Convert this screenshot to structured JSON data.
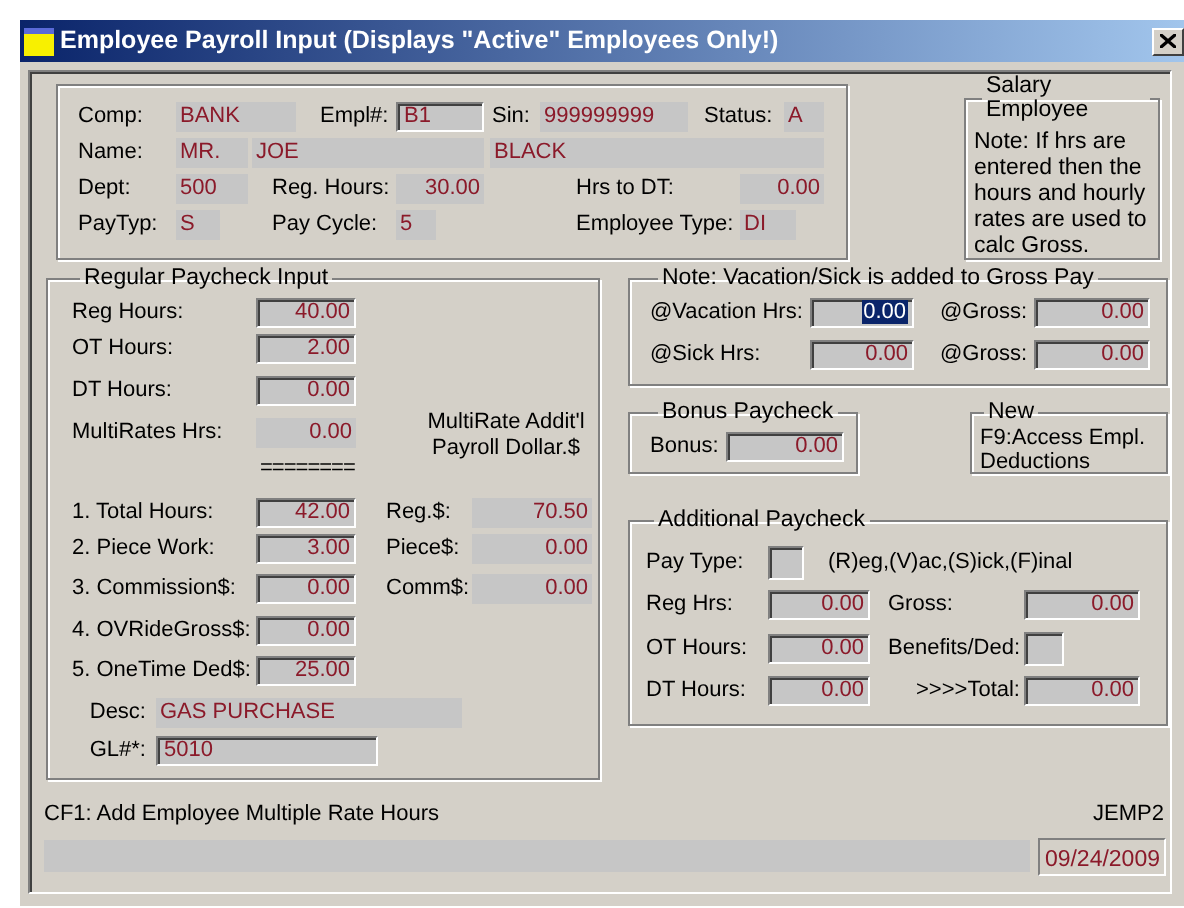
{
  "window": {
    "title": "Employee Payroll Input (Displays \"Active\" Employees Only!)"
  },
  "employee": {
    "comp": {
      "label": "Comp:",
      "value": "BANK",
      "sunken": false
    },
    "empl": {
      "label": "Empl#:",
      "value": "B1",
      "sunken": true
    },
    "sin": {
      "label": "Sin:",
      "value": "999999999",
      "sunken": false
    },
    "status": {
      "label": "Status:",
      "value": "A",
      "sunken": false
    },
    "name": {
      "label": "Name:",
      "values": [
        "MR.",
        "JOE",
        "BLACK"
      ]
    },
    "dept": {
      "label": "Dept:",
      "value": "500",
      "sunken": false
    },
    "reg_hours": {
      "label": "Reg. Hours:",
      "value": "30.00",
      "sunken": false
    },
    "hrs_to_dt": {
      "label": "Hrs to DT:",
      "value": "0.00",
      "sunken": false
    },
    "pay_typ": {
      "label": "PayTyp:",
      "value": "S",
      "sunken": false
    },
    "pay_cycle": {
      "label": "Pay Cycle:",
      "value": "5",
      "sunken": false
    },
    "employee_type": {
      "label": "Employee Type:",
      "value": "DI",
      "sunken": false
    }
  },
  "salary_note": {
    "title": "Salary Employee",
    "text": "Note: If hrs are entered then the hours and hourly rates are used to calc Gross."
  },
  "regular_paycheck": {
    "title": "Regular Paycheck Input",
    "reg_hours": {
      "label": "Reg Hours:",
      "value": "40.00",
      "sunken": true
    },
    "ot_hours": {
      "label": "OT Hours:",
      "value": "2.00",
      "sunken": true
    },
    "dt_hours": {
      "label": "DT Hours:",
      "value": "0.00",
      "sunken": true
    },
    "multirates_hrs": {
      "label": "MultiRates Hrs:",
      "value": "0.00",
      "sunken": false
    },
    "multirate_note": "MultiRate Addit'l Payroll Dollar.$",
    "separator": "========",
    "total_hours": {
      "label": "1. Total Hours:",
      "value": "42.00",
      "sunken": true
    },
    "reg_dollars": {
      "label": "Reg.$:",
      "value": "70.50",
      "sunken": false
    },
    "piece_work": {
      "label": "2. Piece Work:",
      "value": "3.00",
      "sunken": true
    },
    "piece_dollars": {
      "label": "Piece$:",
      "value": "0.00",
      "sunken": false
    },
    "commission": {
      "label": "3. Commission$:",
      "value": "0.00",
      "sunken": true
    },
    "comm_dollars": {
      "label": "Comm$:",
      "value": "0.00",
      "sunken": false
    },
    "ovride_gross": {
      "label": "4. OVRideGross$:",
      "value": "0.00",
      "sunken": true
    },
    "onetime_ded": {
      "label": "5. OneTime Ded$:",
      "value": "25.00",
      "sunken": true
    },
    "desc": {
      "label": "Desc:",
      "value": "GAS PURCHASE",
      "sunken": false
    },
    "gl": {
      "label": "GL#*:",
      "value": "5010",
      "sunken": true
    }
  },
  "vacation_sick": {
    "title": "Note: Vacation/Sick is added to Gross Pay",
    "fields": [
      {
        "label": "@Vacation Hrs:",
        "value": "0.00",
        "sunken": true,
        "highlighted": true
      },
      {
        "label": "@Gross:",
        "value": "0.00",
        "sunken": true,
        "highlighted": false
      },
      {
        "label": "@Sick Hrs:",
        "value": "0.00",
        "sunken": true,
        "highlighted": false
      },
      {
        "label": "@Gross:",
        "value": "0.00",
        "sunken": true,
        "highlighted": false
      }
    ]
  },
  "bonus": {
    "title": "Bonus Paycheck",
    "bonus": {
      "label": "Bonus:",
      "value": "0.00",
      "sunken": true
    }
  },
  "new_note": {
    "title": "New",
    "text": "F9:Access Empl. Deductions"
  },
  "additional": {
    "title": "Additional Paycheck",
    "pay_type": {
      "label": "Pay Type:",
      "sunken": true
    },
    "pay_type_hint": "(R)eg,(V)ac,(S)ick,(F)inal",
    "reg_hrs": {
      "label": "Reg Hrs:",
      "value": "0.00",
      "sunken": true
    },
    "gross": {
      "label": "Gross:",
      "value": "0.00",
      "sunken": true
    },
    "ot_hours": {
      "label": "OT Hours:",
      "value": "0.00",
      "sunken": true
    },
    "benefits_ded": {
      "label": "Benefits/Ded:",
      "sunken": true
    },
    "dt_hours": {
      "label": "DT Hours:",
      "value": "0.00",
      "sunken": true
    },
    "total": {
      "label": ">>>>Total:",
      "value": "0.00",
      "sunken": true
    }
  },
  "footer": {
    "hint": "CF1: Add Employee Multiple Rate Hours",
    "program": "JEMP2",
    "date": "09/24/2009"
  }
}
